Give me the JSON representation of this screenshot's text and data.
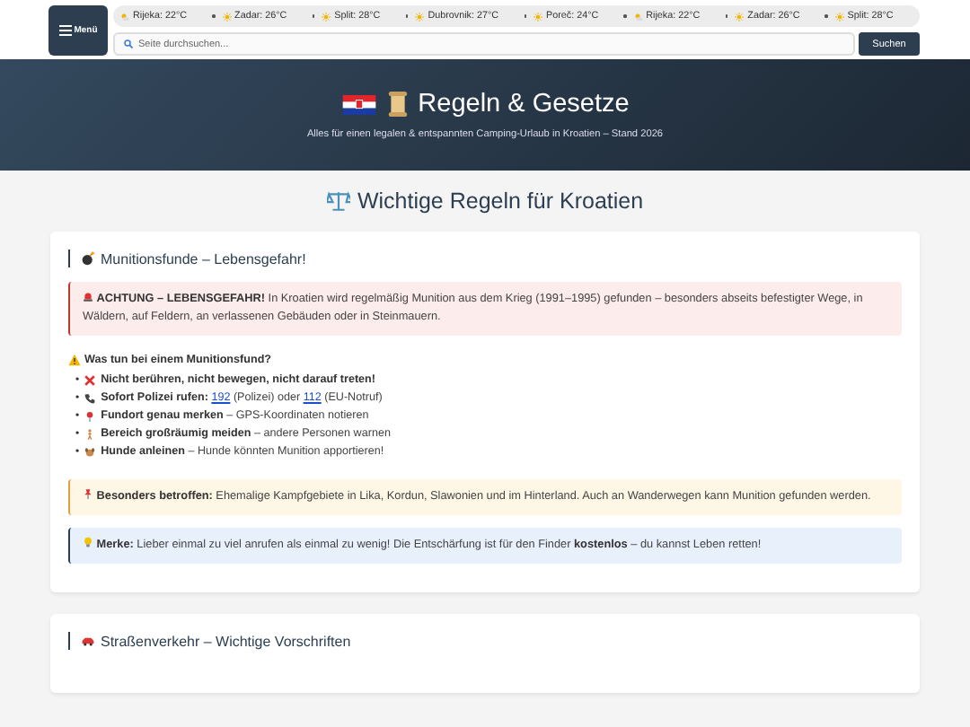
{
  "menu_button": {
    "label": "Menü"
  },
  "weather_ticker": [
    {
      "city": "Rijeka: 22°C",
      "kind": "partly_cloudy"
    },
    {
      "city": "Zadar: 26°C",
      "kind": "sunny"
    },
    {
      "city": "Split: 28°C",
      "kind": "sunny"
    },
    {
      "city": "Dubrovnik: 27°C",
      "kind": "sunny"
    },
    {
      "city": "Poreč: 24°C",
      "kind": "sunny"
    },
    {
      "city": "Rijeka: 22°C",
      "kind": "partly_cloudy"
    },
    {
      "city": "Zadar: 26°C",
      "kind": "sunny"
    },
    {
      "city": "Split: 28°C",
      "kind": "sunny"
    }
  ],
  "search": {
    "placeholder": "Seite durchsuchen...",
    "button": "Suchen"
  },
  "hero": {
    "title": "Regeln & Gesetze",
    "subtitle": "Alles für einen legalen & entspannten Camping-Urlaub in Kroatien – Stand 2026"
  },
  "section_title": "Wichtige Regeln für Kroatien",
  "cards": [
    {
      "title": "Munitionsfunde – Lebensgefahr!",
      "kind": "bomb",
      "danger": "**ACHTUNG – LEBENSGEFAHR!** In Kroatien wird regelmäßig Munition aus dem Krieg (1991–1995) gefunden – besonders abseits befestigter Wege, in Wäldern, auf Feldern, an verlassenen Gebäuden oder in Steinmauern.",
      "subheading": "Was tun bei einem Munitionsfund?",
      "items": [
        {
          "marker": "•",
          "kind": "cross",
          "parts": [
            {
              "kind": "text",
              "text": "**Nicht berühren, nicht bewegen, nicht darauf treten!**"
            }
          ]
        },
        {
          "marker": "•",
          "kind": "phone",
          "parts": [
            {
              "kind": "text",
              "text": "**Sofort Polizei rufen:** "
            },
            {
              "kind": "link",
              "text": "192"
            },
            {
              "kind": "text",
              "text": " (Polizei) oder "
            },
            {
              "kind": "link",
              "text": "112"
            },
            {
              "kind": "text",
              "text": " (EU-Notruf)"
            }
          ]
        },
        {
          "marker": "•",
          "kind": "pin",
          "parts": [
            {
              "kind": "text",
              "text": "**Fundort genau merken** – GPS-Koordinaten notieren"
            }
          ]
        },
        {
          "marker": "•",
          "kind": "person",
          "parts": [
            {
              "kind": "text",
              "text": "**Bereich großräumig meiden** – andere Personen warnen"
            }
          ]
        },
        {
          "marker": "•",
          "kind": "dog",
          "parts": [
            {
              "kind": "text",
              "text": "**Hunde anleinen** – Hunde könnten Munition apportieren!"
            }
          ]
        }
      ],
      "warning": "**Besonders betroffen:** Ehemalige Kampfgebiete in Lika, Kordun, Slawonien und im Hinterland. Auch an Wanderwegen kann Munition gefunden werden.",
      "info": "**Merke:** Lieber einmal zu viel anrufen als einmal zu wenig! Die Entschärfung ist für den Finder **kostenlos** – du kannst Leben retten!"
    },
    {
      "title": "Straßenverkehr – Wichtige Vorschriften",
      "kind": "car"
    }
  ]
}
